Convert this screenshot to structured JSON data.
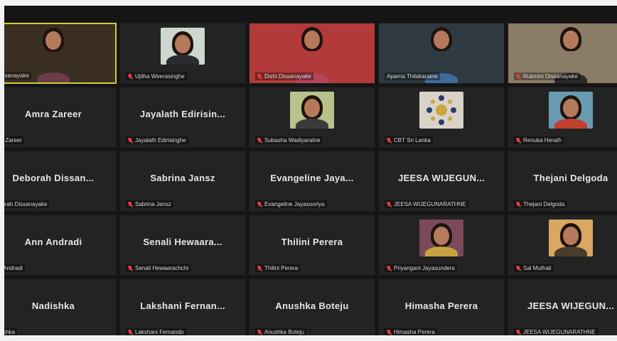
{
  "tiles": [
    {
      "name": "",
      "label": "Disanayake",
      "type": "video",
      "bg": "#3a2f22",
      "body": "#6b3d4a",
      "active": true,
      "muted": false
    },
    {
      "name": "",
      "label": "Ujitha Weerasinghe",
      "type": "photo",
      "bg": "#cfd6d0",
      "body": "#2a2a30",
      "active": false,
      "muted": true
    },
    {
      "name": "",
      "label": "Dishi Dissanayake",
      "type": "video",
      "bg": "#b23a3a",
      "body": "#b8445a",
      "active": false,
      "muted": true
    },
    {
      "name": "",
      "label": "Aparna Thilakaratne",
      "type": "video",
      "bg": "#2e3a40",
      "body": "#3d6c9a",
      "active": false,
      "muted": false
    },
    {
      "name": "",
      "label": "Rukmini Dissanayake",
      "type": "video",
      "bg": "#8a7c66",
      "body": "#2a2a2a",
      "active": false,
      "muted": true
    },
    {
      "name": "Amra Zareer",
      "label": "ra Zareer",
      "type": "name",
      "muted": false
    },
    {
      "name": "Jayalath Edirisin...",
      "label": "Jayalath Edirisinghe",
      "type": "name",
      "muted": true
    },
    {
      "name": "",
      "label": "Subasha Wadiyaratne",
      "type": "photo",
      "bg": "#b8c28a",
      "body": "#3a3a3a",
      "muted": true
    },
    {
      "name": "",
      "label": "CBT Sri Lanka",
      "type": "logo",
      "bg": "#d8d2c8",
      "muted": true
    },
    {
      "name": "",
      "label": "Renuka Herath",
      "type": "photo",
      "bg": "#6a9ab0",
      "body": "#c2402e",
      "muted": true
    },
    {
      "name": "Deborah  Dissan...",
      "label": "borah Dissanayake",
      "type": "name",
      "muted": false
    },
    {
      "name": "Sabrina  Jansz",
      "label": "Sabrina Jansz",
      "type": "name",
      "muted": true
    },
    {
      "name": "Evangeline  Jaya...",
      "label": "Evangeline Jayasooriya",
      "type": "name",
      "muted": true
    },
    {
      "name": "JEESA  WIJEGUN...",
      "label": "JEESA WIJEGUNARATHNE",
      "type": "name",
      "muted": true
    },
    {
      "name": "Thejani  Delgoda",
      "label": "Thejani Delgoda",
      "type": "name",
      "muted": true
    },
    {
      "name": "Ann  Andradi",
      "label": "n Andradi",
      "type": "name",
      "muted": false
    },
    {
      "name": "Senali  Hewaara...",
      "label": "Senali Hewaarachchi",
      "type": "name",
      "muted": true
    },
    {
      "name": "Thilini  Perera",
      "label": "Thilini Perera",
      "type": "name",
      "muted": true
    },
    {
      "name": "",
      "label": "Priyangani Jayasundera",
      "type": "photo",
      "bg": "#7a4a5a",
      "body": "#c9a340",
      "muted": true
    },
    {
      "name": "",
      "label": "Sal Muthali",
      "type": "photo",
      "bg": "#d8a862",
      "body": "#4a3a2a",
      "muted": true
    },
    {
      "name": "Nadishka",
      "label": "dishka",
      "type": "name",
      "muted": false
    },
    {
      "name": "Lakshani  Fernan...",
      "label": "Lakshani Fernando",
      "type": "name",
      "muted": true
    },
    {
      "name": "Anushka  Boteju",
      "label": "Anushka Boteju",
      "type": "name",
      "muted": true
    },
    {
      "name": "Himasha  Perera",
      "label": "Himasha Perera",
      "type": "name",
      "muted": true
    },
    {
      "name": "JEESA  WIJEGUN...",
      "label": "JEESA WIJEGUNARATHNE",
      "type": "name",
      "muted": true
    }
  ]
}
